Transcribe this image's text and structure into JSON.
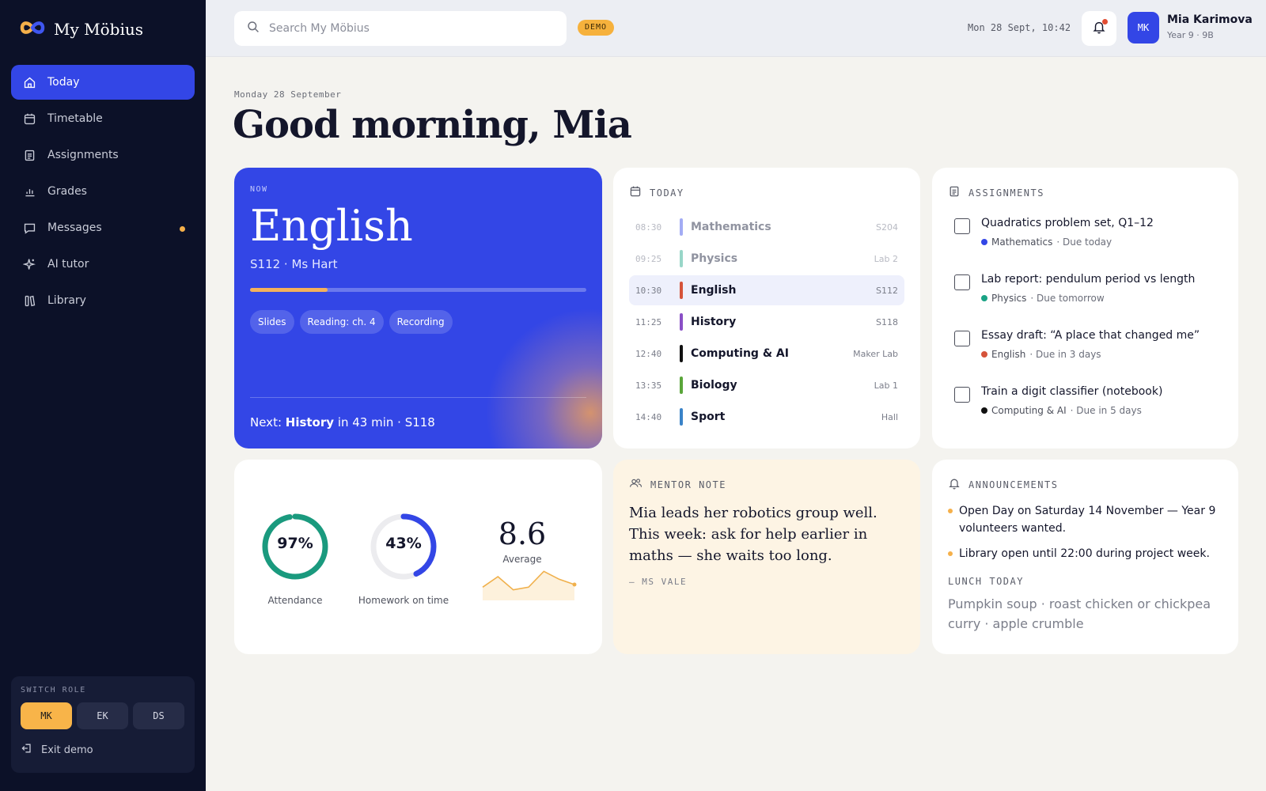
{
  "app": {
    "name": "My Möbius"
  },
  "sidebar": {
    "items": [
      {
        "label": "Today",
        "icon": "home-icon",
        "active": true
      },
      {
        "label": "Timetable",
        "icon": "calendar-icon"
      },
      {
        "label": "Assignments",
        "icon": "document-icon"
      },
      {
        "label": "Grades",
        "icon": "bar-chart-icon"
      },
      {
        "label": "Messages",
        "icon": "chat-icon",
        "unread": true
      },
      {
        "label": "AI tutor",
        "icon": "sparkle-icon"
      },
      {
        "label": "Library",
        "icon": "books-icon"
      }
    ],
    "switch_role": {
      "label": "SWITCH ROLE",
      "roles": [
        "MK",
        "EK",
        "DS"
      ],
      "active": "MK"
    },
    "exit_label": "Exit demo"
  },
  "topbar": {
    "search_placeholder": "Search My Möbius",
    "demo_badge": "DEMO",
    "datetime": "Mon 28 Sept, 10:42",
    "user": {
      "initials": "MK",
      "name": "Mia Karimova",
      "class": "Year 9 · 9B"
    }
  },
  "main": {
    "date_label": "Monday 28 September",
    "greeting": "Good morning, Mia"
  },
  "now": {
    "label": "NOW",
    "subject": "English",
    "room_teacher": "S112 · Ms Hart",
    "progress": 0.23,
    "chips": [
      "Slides",
      "Reading: ch. 4",
      "Recording"
    ],
    "next_prefix": "Next: ",
    "next_subject": "History",
    "next_suffix": " in 43 min · S118"
  },
  "today": {
    "title": "TODAY",
    "schedule": [
      {
        "time": "08:30",
        "subject": "Mathematics",
        "room": "S204",
        "color": "#3346e6",
        "state": "past"
      },
      {
        "time": "09:25",
        "subject": "Physics",
        "room": "Lab 2",
        "color": "#1aa385",
        "state": "past"
      },
      {
        "time": "10:30",
        "subject": "English",
        "room": "S112",
        "color": "#d5533a",
        "state": "current"
      },
      {
        "time": "11:25",
        "subject": "History",
        "room": "S118",
        "color": "#8a4fc6",
        "state": "upcoming"
      },
      {
        "time": "12:40",
        "subject": "Computing & AI",
        "room": "Maker Lab",
        "color": "#111111",
        "state": "upcoming"
      },
      {
        "time": "13:35",
        "subject": "Biology",
        "room": "Lab 1",
        "color": "#5aa63a",
        "state": "upcoming"
      },
      {
        "time": "14:40",
        "subject": "Sport",
        "room": "Hall",
        "color": "#3a83c8",
        "state": "upcoming"
      }
    ]
  },
  "assignments": {
    "title": "ASSIGNMENTS",
    "items": [
      {
        "title": "Quadratics problem set, Q1–12",
        "subject": "Mathematics",
        "due": "· Due today",
        "color": "#3346e6"
      },
      {
        "title": "Lab report: pendulum period vs length",
        "subject": "Physics",
        "due": "· Due tomorrow",
        "color": "#1aa385"
      },
      {
        "title": "Essay draft: “A place that changed me”",
        "subject": "English",
        "due": "· Due in 3 days",
        "color": "#d5533a"
      },
      {
        "title": "Train a digit classifier (notebook)",
        "subject": "Computing & AI",
        "due": "· Due in 5 days",
        "color": "#111111"
      }
    ]
  },
  "stats": {
    "attendance": {
      "value": "97%",
      "fraction": 0.97,
      "label": "Attendance",
      "color": "#1a9a7e"
    },
    "homework": {
      "value": "43%",
      "fraction": 0.43,
      "label": "Homework on time",
      "color": "#3346e6"
    },
    "average": {
      "value": "8.6",
      "label": "Average",
      "trend": [
        7.9,
        8.3,
        7.8,
        7.9,
        8.5,
        8.2,
        8.0
      ]
    }
  },
  "mentor": {
    "title": "MENTOR NOTE",
    "text": "Mia leads her robotics group well. This week: ask for help earlier in maths — she waits too long.",
    "author": "— MS VALE"
  },
  "announcements": {
    "title": "ANNOUNCEMENTS",
    "items": [
      "Open Day on Saturday 14 November — Year 9 volunteers wanted.",
      "Library open until 22:00 during project week."
    ],
    "lunch_title": "LUNCH TODAY",
    "lunch_text": "Pumpkin soup · roast chicken or chickpea curry · apple crumble"
  },
  "colors": {
    "accent": "#3346e6",
    "amber": "#f5b04a",
    "sidebar_bg": "#0c1128"
  }
}
